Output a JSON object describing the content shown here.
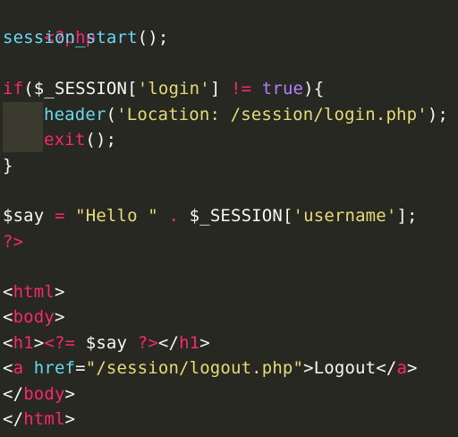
{
  "editor": {
    "theme_colors": {
      "background": "#272822",
      "keyword": "#F92672",
      "function": "#66D9EF",
      "string": "#E6DB74",
      "constant": "#AE81FF",
      "plain": "#F8F8F2"
    },
    "lines": {
      "l1": {
        "open_tag": "<?php"
      },
      "l2": {
        "fn": "session_start",
        "rest": "();"
      },
      "l4": {
        "kw": "if",
        "p1": "(",
        "var": "$_SESSION",
        "b1": "[",
        "key": "'login'",
        "b2": "]",
        "op": " != ",
        "const": "true",
        "p2": ")",
        "brace": "{"
      },
      "l5": {
        "fn": "header",
        "p1": "(",
        "str": "'Location: /session/login.php'",
        "p2": ");"
      },
      "l6": {
        "kw": "exit",
        "rest": "();"
      },
      "l7": {
        "brace": "}"
      },
      "l9": {
        "var": "$say",
        "op": " = ",
        "str": "\"Hello \"",
        "dot": " . ",
        "var2": "$_SESSION",
        "b1": "[",
        "key": "'username'",
        "b2": "];"
      },
      "l10": {
        "close_tag": "?>"
      },
      "l12": {
        "lt": "<",
        "tag": "html",
        "gt": ">"
      },
      "l13": {
        "lt": "<",
        "tag": "body",
        "gt": ">"
      },
      "l14": {
        "lt": "<",
        "tag": "h1",
        "gt": ">",
        "php_open": "<?=",
        "sp": " ",
        "var": "$say",
        "sp2": " ",
        "php_close": "?>",
        "lt2": "</",
        "tag2": "h1",
        "gt2": ">"
      },
      "l15": {
        "lt": "<",
        "tag": "a",
        "sp": " ",
        "attr": "href",
        "eq": "=",
        "val": "\"/session/logout.php\"",
        "gt": ">",
        "text": "Logout",
        "lt2": "</",
        "tag2": "a",
        "gt2": ">"
      },
      "l16": {
        "lt": "</",
        "tag": "body",
        "gt": ">"
      },
      "l17": {
        "lt": "</",
        "tag": "html",
        "gt": ">"
      }
    }
  }
}
